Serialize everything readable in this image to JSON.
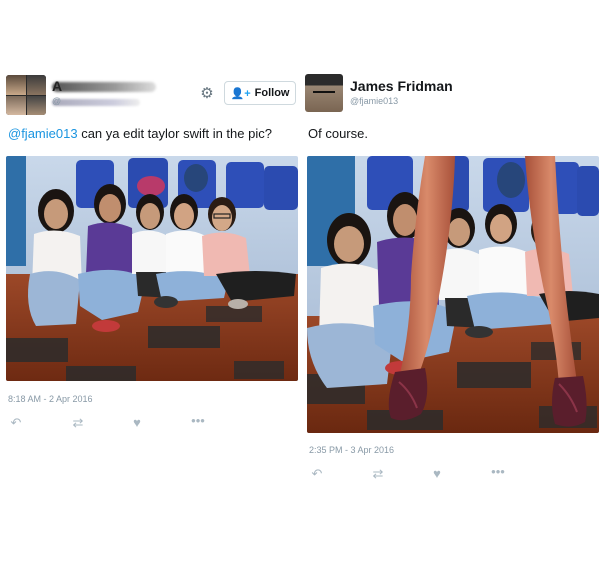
{
  "left_tweet": {
    "author_initial": "A",
    "handle_prefix": "@",
    "follow_label": "Follow",
    "text_mention": "@fjamie013",
    "text_body": " can ya edit taylor swift in the pic?",
    "timestamp": "8:18 AM - 2 Apr 2016"
  },
  "right_tweet": {
    "author_name": "James Fridman",
    "author_handle": "@fjamie013",
    "text": "Of course.",
    "timestamp": "2:35 PM - 3 Apr 2016"
  },
  "icons": {
    "reply": "reply-icon",
    "retweet": "retweet-icon",
    "like": "heart-icon",
    "more": "more-icon",
    "settings": "gear-icon",
    "follow": "add-user-icon"
  },
  "colors": {
    "link": "#1b95e0",
    "muted": "#8899a6",
    "action": "#aab8c2",
    "floor": "#8a3a1e",
    "chairs": "#2e4fb8"
  }
}
